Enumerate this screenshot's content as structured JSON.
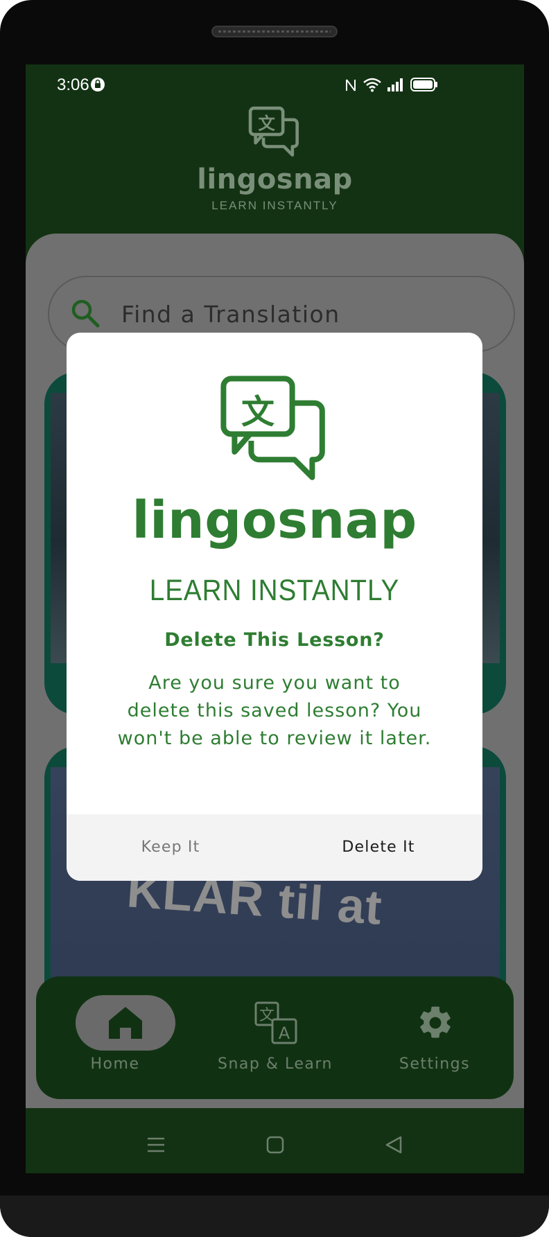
{
  "status_bar": {
    "time": "3:06"
  },
  "header": {
    "app_name": "lingosnap",
    "tagline": "LEARN INSTANTLY"
  },
  "search": {
    "placeholder": "Find a Translation"
  },
  "cards": [
    {
      "image_text": ""
    },
    {
      "image_text": "KLAR til at"
    }
  ],
  "bottom_nav": {
    "items": [
      {
        "label": "Home",
        "icon": "home-icon",
        "active": true
      },
      {
        "label": "Snap & Learn",
        "icon": "translate-icon",
        "active": false
      },
      {
        "label": "Settings",
        "icon": "gear-icon",
        "active": false
      }
    ]
  },
  "dialog": {
    "app_name": "lingosnap",
    "tagline": "LEARN INSTANTLY",
    "title": "Delete This Lesson?",
    "message": "Are you sure you want to delete this saved lesson? You won't be able to review it later.",
    "cancel_label": "Keep It",
    "confirm_label": "Delete It"
  },
  "colors": {
    "brand_green": "#2e7d32",
    "dark_green": "#133213",
    "scrim_gray": "#707070"
  }
}
